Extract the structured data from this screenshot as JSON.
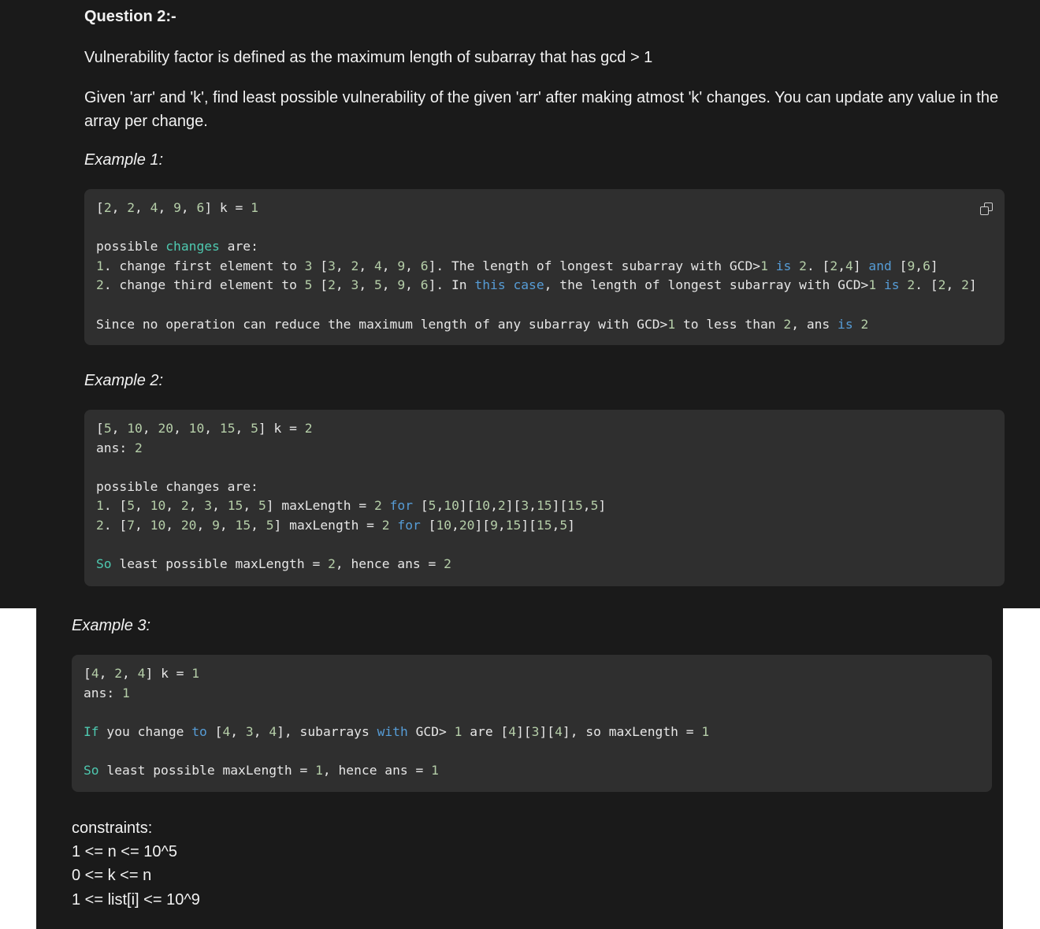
{
  "question": {
    "title": "Question 2:-",
    "definition": "Vulnerability factor is defined as the maximum length of subarray that has gcd > 1",
    "task": "Given 'arr' and 'k', find least possible vulnerability of the given 'arr' after making atmost 'k' changes. You can update any value in the array per change."
  },
  "examples": [
    {
      "label": "Example 1:",
      "lines": [
        [
          [
            "p",
            "["
          ],
          [
            "n",
            "2"
          ],
          [
            "p",
            ", "
          ],
          [
            "n",
            "2"
          ],
          [
            "p",
            ", "
          ],
          [
            "n",
            "4"
          ],
          [
            "p",
            ", "
          ],
          [
            "n",
            "9"
          ],
          [
            "p",
            ", "
          ],
          [
            "n",
            "6"
          ],
          [
            "p",
            "] k = "
          ],
          [
            "n",
            "1"
          ]
        ],
        [],
        [
          [
            "p",
            "possible "
          ],
          [
            "t",
            "changes"
          ],
          [
            "p",
            " are:"
          ]
        ],
        [
          [
            "n",
            "1"
          ],
          [
            "p",
            ". change first element to "
          ],
          [
            "n",
            "3"
          ],
          [
            "p",
            " ["
          ],
          [
            "n",
            "3"
          ],
          [
            "p",
            ", "
          ],
          [
            "n",
            "2"
          ],
          [
            "p",
            ", "
          ],
          [
            "n",
            "4"
          ],
          [
            "p",
            ", "
          ],
          [
            "n",
            "9"
          ],
          [
            "p",
            ", "
          ],
          [
            "n",
            "6"
          ],
          [
            "p",
            "]. The length of longest subarray with GCD>"
          ],
          [
            "n",
            "1"
          ],
          [
            "p",
            " "
          ],
          [
            "k",
            "is"
          ],
          [
            "p",
            " "
          ],
          [
            "n",
            "2"
          ],
          [
            "p",
            ". ["
          ],
          [
            "n",
            "2"
          ],
          [
            "p",
            ","
          ],
          [
            "n",
            "4"
          ],
          [
            "p",
            "] "
          ],
          [
            "k",
            "and"
          ],
          [
            "p",
            " ["
          ],
          [
            "n",
            "9"
          ],
          [
            "p",
            ","
          ],
          [
            "n",
            "6"
          ],
          [
            "p",
            "]"
          ]
        ],
        [
          [
            "n",
            "2"
          ],
          [
            "p",
            ". change third element to "
          ],
          [
            "n",
            "5"
          ],
          [
            "p",
            " ["
          ],
          [
            "n",
            "2"
          ],
          [
            "p",
            ", "
          ],
          [
            "n",
            "3"
          ],
          [
            "p",
            ", "
          ],
          [
            "n",
            "5"
          ],
          [
            "p",
            ", "
          ],
          [
            "n",
            "9"
          ],
          [
            "p",
            ", "
          ],
          [
            "n",
            "6"
          ],
          [
            "p",
            "]. In "
          ],
          [
            "k",
            "this"
          ],
          [
            "p",
            " "
          ],
          [
            "k",
            "case"
          ],
          [
            "p",
            ", the length of longest subarray with GCD>"
          ],
          [
            "n",
            "1"
          ],
          [
            "p",
            " "
          ],
          [
            "k",
            "is"
          ],
          [
            "p",
            " "
          ],
          [
            "n",
            "2"
          ],
          [
            "p",
            ". ["
          ],
          [
            "n",
            "2"
          ],
          [
            "p",
            ", "
          ],
          [
            "n",
            "2"
          ],
          [
            "p",
            "]"
          ]
        ],
        [],
        [
          [
            "p",
            "Since no operation can reduce the maximum length of any subarray with GCD>"
          ],
          [
            "n",
            "1"
          ],
          [
            "p",
            " to less than "
          ],
          [
            "n",
            "2"
          ],
          [
            "p",
            ", ans "
          ],
          [
            "k",
            "is"
          ],
          [
            "p",
            " "
          ],
          [
            "n",
            "2"
          ]
        ]
      ]
    },
    {
      "label": "Example 2:",
      "lines": [
        [
          [
            "p",
            "["
          ],
          [
            "n",
            "5"
          ],
          [
            "p",
            ", "
          ],
          [
            "n",
            "10"
          ],
          [
            "p",
            ", "
          ],
          [
            "n",
            "20"
          ],
          [
            "p",
            ", "
          ],
          [
            "n",
            "10"
          ],
          [
            "p",
            ", "
          ],
          [
            "n",
            "15"
          ],
          [
            "p",
            ", "
          ],
          [
            "n",
            "5"
          ],
          [
            "p",
            "] k = "
          ],
          [
            "n",
            "2"
          ]
        ],
        [
          [
            "p",
            "ans: "
          ],
          [
            "n",
            "2"
          ]
        ],
        [],
        [
          [
            "p",
            "possible changes are:"
          ]
        ],
        [
          [
            "n",
            "1"
          ],
          [
            "p",
            ". ["
          ],
          [
            "n",
            "5"
          ],
          [
            "p",
            ", "
          ],
          [
            "n",
            "10"
          ],
          [
            "p",
            ", "
          ],
          [
            "n",
            "2"
          ],
          [
            "p",
            ", "
          ],
          [
            "n",
            "3"
          ],
          [
            "p",
            ", "
          ],
          [
            "n",
            "15"
          ],
          [
            "p",
            ", "
          ],
          [
            "n",
            "5"
          ],
          [
            "p",
            "] maxLength = "
          ],
          [
            "n",
            "2"
          ],
          [
            "p",
            " "
          ],
          [
            "k",
            "for"
          ],
          [
            "p",
            " ["
          ],
          [
            "n",
            "5"
          ],
          [
            "p",
            ","
          ],
          [
            "n",
            "10"
          ],
          [
            "p",
            "]["
          ],
          [
            "n",
            "10"
          ],
          [
            "p",
            ","
          ],
          [
            "n",
            "2"
          ],
          [
            "p",
            "]["
          ],
          [
            "n",
            "3"
          ],
          [
            "p",
            ","
          ],
          [
            "n",
            "15"
          ],
          [
            "p",
            "]["
          ],
          [
            "n",
            "15"
          ],
          [
            "p",
            ","
          ],
          [
            "n",
            "5"
          ],
          [
            "p",
            "]"
          ]
        ],
        [
          [
            "n",
            "2"
          ],
          [
            "p",
            ". ["
          ],
          [
            "n",
            "7"
          ],
          [
            "p",
            ", "
          ],
          [
            "n",
            "10"
          ],
          [
            "p",
            ", "
          ],
          [
            "n",
            "20"
          ],
          [
            "p",
            ", "
          ],
          [
            "n",
            "9"
          ],
          [
            "p",
            ", "
          ],
          [
            "n",
            "15"
          ],
          [
            "p",
            ", "
          ],
          [
            "n",
            "5"
          ],
          [
            "p",
            "] maxLength = "
          ],
          [
            "n",
            "2"
          ],
          [
            "p",
            " "
          ],
          [
            "k",
            "for"
          ],
          [
            "p",
            " ["
          ],
          [
            "n",
            "10"
          ],
          [
            "p",
            ","
          ],
          [
            "n",
            "20"
          ],
          [
            "p",
            "]["
          ],
          [
            "n",
            "9"
          ],
          [
            "p",
            ","
          ],
          [
            "n",
            "15"
          ],
          [
            "p",
            "]["
          ],
          [
            "n",
            "15"
          ],
          [
            "p",
            ","
          ],
          [
            "n",
            "5"
          ],
          [
            "p",
            "]"
          ]
        ],
        [],
        [
          [
            "t",
            "So"
          ],
          [
            "p",
            " least possible maxLength = "
          ],
          [
            "n",
            "2"
          ],
          [
            "p",
            ", hence ans = "
          ],
          [
            "n",
            "2"
          ]
        ]
      ]
    },
    {
      "label": "Example 3:",
      "lines": [
        [
          [
            "p",
            "["
          ],
          [
            "n",
            "4"
          ],
          [
            "p",
            ", "
          ],
          [
            "n",
            "2"
          ],
          [
            "p",
            ", "
          ],
          [
            "n",
            "4"
          ],
          [
            "p",
            "] k = "
          ],
          [
            "n",
            "1"
          ]
        ],
        [
          [
            "p",
            "ans: "
          ],
          [
            "n",
            "1"
          ]
        ],
        [],
        [
          [
            "t",
            "If"
          ],
          [
            "p",
            " you change "
          ],
          [
            "k",
            "to"
          ],
          [
            "p",
            " ["
          ],
          [
            "n",
            "4"
          ],
          [
            "p",
            ", "
          ],
          [
            "n",
            "3"
          ],
          [
            "p",
            ", "
          ],
          [
            "n",
            "4"
          ],
          [
            "p",
            "], subarrays "
          ],
          [
            "k",
            "with"
          ],
          [
            "p",
            " GCD> "
          ],
          [
            "n",
            "1"
          ],
          [
            "p",
            " are ["
          ],
          [
            "n",
            "4"
          ],
          [
            "p",
            "]["
          ],
          [
            "n",
            "3"
          ],
          [
            "p",
            "]["
          ],
          [
            "n",
            "4"
          ],
          [
            "p",
            "], so maxLength = "
          ],
          [
            "n",
            "1"
          ]
        ],
        [],
        [
          [
            "t",
            "So"
          ],
          [
            "p",
            " least possible maxLength = "
          ],
          [
            "n",
            "1"
          ],
          [
            "p",
            ", hence ans = "
          ],
          [
            "n",
            "1"
          ]
        ]
      ]
    }
  ],
  "constraints": {
    "title": "constraints:",
    "items": [
      "1 <= n <= 10^5",
      "0 <= k <= n",
      "1 <= list[i] <= 10^9"
    ]
  },
  "icons": {
    "copy": "copy-icon"
  },
  "colors": {
    "background": "#1a1a1a",
    "code_background": "#2f2f2f",
    "number": "#b5cea8",
    "keyword": "#569cd6",
    "type": "#4ec9b0"
  }
}
